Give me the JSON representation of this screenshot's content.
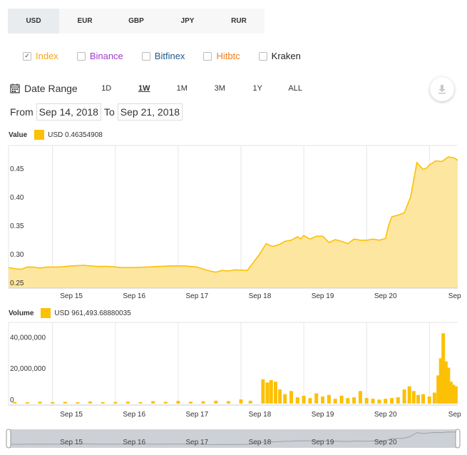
{
  "currencies": [
    "USD",
    "EUR",
    "GBP",
    "JPY",
    "RUR"
  ],
  "exchanges": [
    {
      "label": "Index",
      "checked": true,
      "color": "#f2a51a"
    },
    {
      "label": "Binance",
      "checked": false,
      "color": "#a03cc8"
    },
    {
      "label": "Bitfinex",
      "checked": false,
      "color": "#1e5a8c"
    },
    {
      "label": "Hitbtc",
      "checked": false,
      "color": "#f07d1e"
    },
    {
      "label": "Kraken",
      "checked": false,
      "color": "#222222"
    }
  ],
  "date_range": {
    "label": "Date Range",
    "buttons": [
      "1D",
      "1W",
      "1M",
      "3M",
      "1Y",
      "ALL"
    ],
    "active": "1W",
    "from_label": "From",
    "from": "Sep 14, 2018",
    "to_label": "To",
    "to": "Sep 21, 2018"
  },
  "value_legend": {
    "label": "Value",
    "series": "USD 0.46354908"
  },
  "volume_legend": {
    "label": "Volume",
    "series": "USD 961,493.68880035"
  },
  "accent_color": "#fcc005",
  "download_icon": "download-icon",
  "chart_data": [
    {
      "type": "area",
      "name": "value",
      "x_ticks": [
        "Sep 15",
        "Sep 16",
        "Sep 17",
        "Sep 18",
        "Sep 19",
        "Sep 20",
        "Sep"
      ],
      "y_ticks": [
        "0.25",
        "0.30",
        "0.35",
        "0.40",
        "0.45"
      ],
      "ylim": [
        0.24,
        0.49
      ],
      "xlim": [
        0,
        7.15
      ],
      "grid": true,
      "x": [
        0,
        0.1,
        0.2,
        0.3,
        0.4,
        0.5,
        0.6,
        0.8,
        1.0,
        1.2,
        1.4,
        1.6,
        1.8,
        2.0,
        2.2,
        2.4,
        2.6,
        2.8,
        3.0,
        3.2,
        3.3,
        3.4,
        3.5,
        3.6,
        3.8,
        4.0,
        4.1,
        4.2,
        4.3,
        4.4,
        4.5,
        4.6,
        4.65,
        4.7,
        4.8,
        4.9,
        5.0,
        5.1,
        5.2,
        5.3,
        5.4,
        5.5,
        5.6,
        5.7,
        5.8,
        5.9,
        6.0,
        6.05,
        6.1,
        6.2,
        6.3,
        6.4,
        6.5,
        6.6,
        6.65,
        6.7,
        6.8,
        6.9,
        7.0,
        7.1,
        7.15
      ],
      "values": [
        0.276,
        0.274,
        0.273,
        0.277,
        0.277,
        0.275,
        0.277,
        0.277,
        0.279,
        0.28,
        0.278,
        0.278,
        0.276,
        0.276,
        0.277,
        0.278,
        0.279,
        0.279,
        0.277,
        0.27,
        0.268,
        0.271,
        0.27,
        0.272,
        0.271,
        0.3,
        0.318,
        0.313,
        0.316,
        0.322,
        0.324,
        0.33,
        0.326,
        0.332,
        0.326,
        0.331,
        0.331,
        0.32,
        0.325,
        0.322,
        0.318,
        0.326,
        0.324,
        0.324,
        0.326,
        0.324,
        0.327,
        0.35,
        0.365,
        0.368,
        0.372,
        0.4,
        0.46,
        0.448,
        0.45,
        0.456,
        0.463,
        0.462,
        0.47,
        0.468,
        0.464
      ]
    },
    {
      "type": "bar",
      "name": "volume",
      "x_ticks": [
        "Sep 15",
        "Sep 16",
        "Sep 17",
        "Sep 18",
        "Sep 19",
        "Sep 20",
        "Sep"
      ],
      "y_ticks": [
        "0",
        "20,000,000",
        "40,000,000"
      ],
      "ylim": [
        -1000000,
        52000000
      ],
      "xlim": [
        0,
        7.15
      ],
      "grid": true,
      "bars": [
        {
          "x": 0.1,
          "value": 1000000
        },
        {
          "x": 0.3,
          "value": 800000
        },
        {
          "x": 0.5,
          "value": 1200000
        },
        {
          "x": 0.7,
          "value": 900000
        },
        {
          "x": 0.9,
          "value": 1100000
        },
        {
          "x": 1.1,
          "value": 800000
        },
        {
          "x": 1.3,
          "value": 1300000
        },
        {
          "x": 1.5,
          "value": 900000
        },
        {
          "x": 1.7,
          "value": 1000000
        },
        {
          "x": 1.9,
          "value": 1200000
        },
        {
          "x": 2.1,
          "value": 900000
        },
        {
          "x": 2.3,
          "value": 1500000
        },
        {
          "x": 2.5,
          "value": 1100000
        },
        {
          "x": 2.7,
          "value": 1700000
        },
        {
          "x": 2.9,
          "value": 1200000
        },
        {
          "x": 3.1,
          "value": 1400000
        },
        {
          "x": 3.3,
          "value": 1800000
        },
        {
          "x": 3.5,
          "value": 1500000
        },
        {
          "x": 3.7,
          "value": 2600000
        },
        {
          "x": 3.85,
          "value": 1800000
        },
        {
          "x": 4.05,
          "value": 15500000
        },
        {
          "x": 4.12,
          "value": 13500000
        },
        {
          "x": 4.18,
          "value": 15000000
        },
        {
          "x": 4.25,
          "value": 14000000
        },
        {
          "x": 4.32,
          "value": 9000000
        },
        {
          "x": 4.4,
          "value": 6000000
        },
        {
          "x": 4.5,
          "value": 8000000
        },
        {
          "x": 4.6,
          "value": 4000000
        },
        {
          "x": 4.7,
          "value": 5000000
        },
        {
          "x": 4.8,
          "value": 3500000
        },
        {
          "x": 4.9,
          "value": 6500000
        },
        {
          "x": 5.0,
          "value": 4500000
        },
        {
          "x": 5.1,
          "value": 5500000
        },
        {
          "x": 5.2,
          "value": 3000000
        },
        {
          "x": 5.3,
          "value": 5000000
        },
        {
          "x": 5.4,
          "value": 3500000
        },
        {
          "x": 5.5,
          "value": 4000000
        },
        {
          "x": 5.6,
          "value": 8000000
        },
        {
          "x": 5.7,
          "value": 3500000
        },
        {
          "x": 5.8,
          "value": 3000000
        },
        {
          "x": 5.9,
          "value": 2500000
        },
        {
          "x": 6.0,
          "value": 3000000
        },
        {
          "x": 6.1,
          "value": 3500000
        },
        {
          "x": 6.2,
          "value": 4000000
        },
        {
          "x": 6.3,
          "value": 9000000
        },
        {
          "x": 6.38,
          "value": 11000000
        },
        {
          "x": 6.45,
          "value": 8000000
        },
        {
          "x": 6.52,
          "value": 5500000
        },
        {
          "x": 6.6,
          "value": 6000000
        },
        {
          "x": 6.7,
          "value": 4500000
        },
        {
          "x": 6.78,
          "value": 7000000
        },
        {
          "x": 6.84,
          "value": 18000000
        },
        {
          "x": 6.88,
          "value": 29000000
        },
        {
          "x": 6.92,
          "value": 45000000
        },
        {
          "x": 6.96,
          "value": 27000000
        },
        {
          "x": 7.0,
          "value": 23000000
        },
        {
          "x": 7.04,
          "value": 14000000
        },
        {
          "x": 7.08,
          "value": 12000000
        },
        {
          "x": 7.12,
          "value": 11000000
        }
      ]
    },
    {
      "type": "area",
      "name": "navigator",
      "x_ticks": [
        "Sep 15",
        "Sep 16",
        "Sep 17",
        "Sep 18",
        "Sep 19",
        "Sep 20"
      ],
      "ylim": [
        0.24,
        0.49
      ],
      "xlim": [
        0,
        7.15
      ]
    }
  ]
}
